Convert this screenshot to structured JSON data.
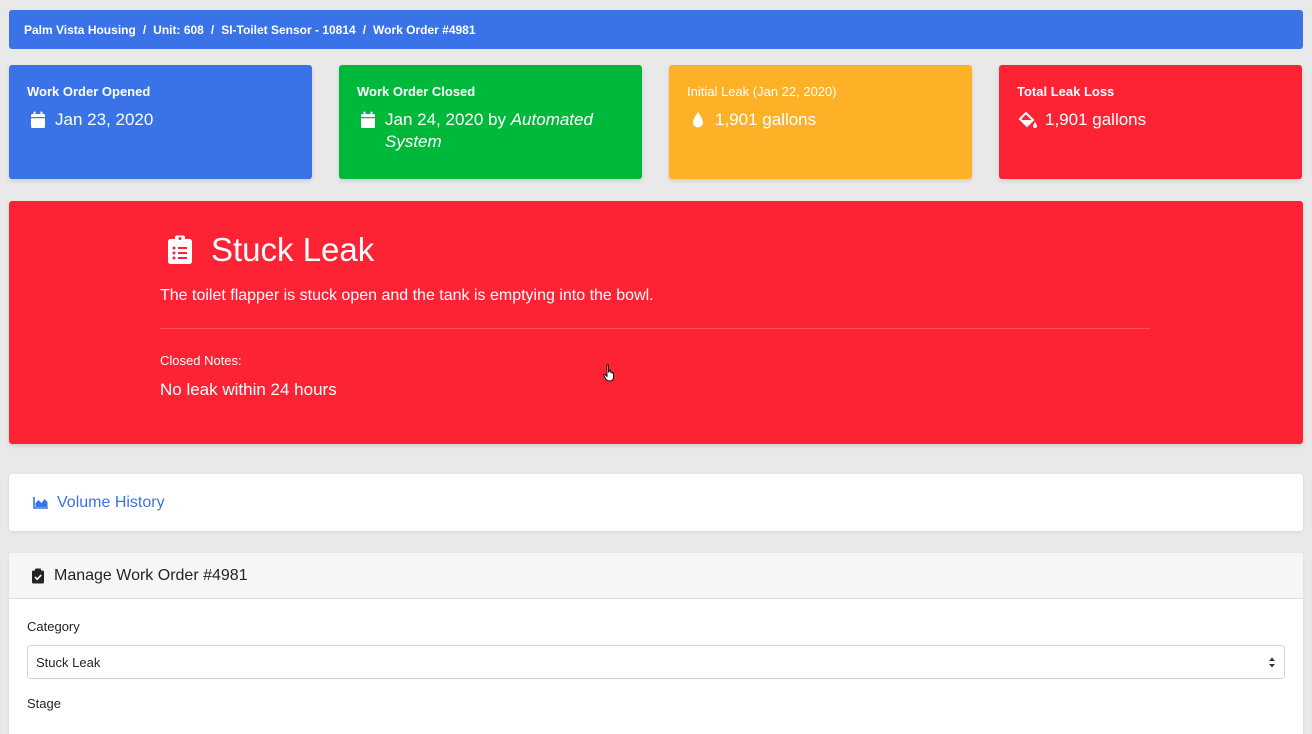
{
  "breadcrumb": {
    "items": [
      "Palm Vista Housing",
      "Unit: 608",
      "SI-Toilet Sensor - 10814",
      "Work Order #4981"
    ],
    "separator": "/"
  },
  "cards": {
    "opened": {
      "title": "Work Order Opened",
      "value": "Jan 23, 2020",
      "icon": "calendar-icon",
      "color": "#3a73e8"
    },
    "closed": {
      "title": "Work Order Closed",
      "value": "Jan 24, 2020 by ",
      "value_em": "Automated System",
      "icon": "calendar-icon",
      "color": "#00b93b"
    },
    "initial": {
      "title": "Initial Leak (Jan 22, 2020)",
      "value": "1,901 gallons",
      "icon": "water-drop-icon",
      "color": "#fdb127"
    },
    "total": {
      "title": "Total Leak Loss",
      "value": "1,901 gallons",
      "icon": "fill-drip-icon",
      "color": "#fe2235"
    }
  },
  "leak": {
    "title": "Stuck Leak",
    "description": "The toilet flapper is stuck open and the tank is emptying into the bowl.",
    "closed_notes_label": "Closed Notes:",
    "closed_notes": "No leak within 24 hours",
    "icon": "clipboard-list-icon",
    "color": "#fe2235"
  },
  "volume_history": {
    "label": "Volume History",
    "icon": "area-chart-icon"
  },
  "manage": {
    "title": "Manage Work Order #4981",
    "icon": "clipboard-check-icon",
    "category_label": "Category",
    "category_value": "Stuck Leak",
    "stage_label": "Stage"
  }
}
